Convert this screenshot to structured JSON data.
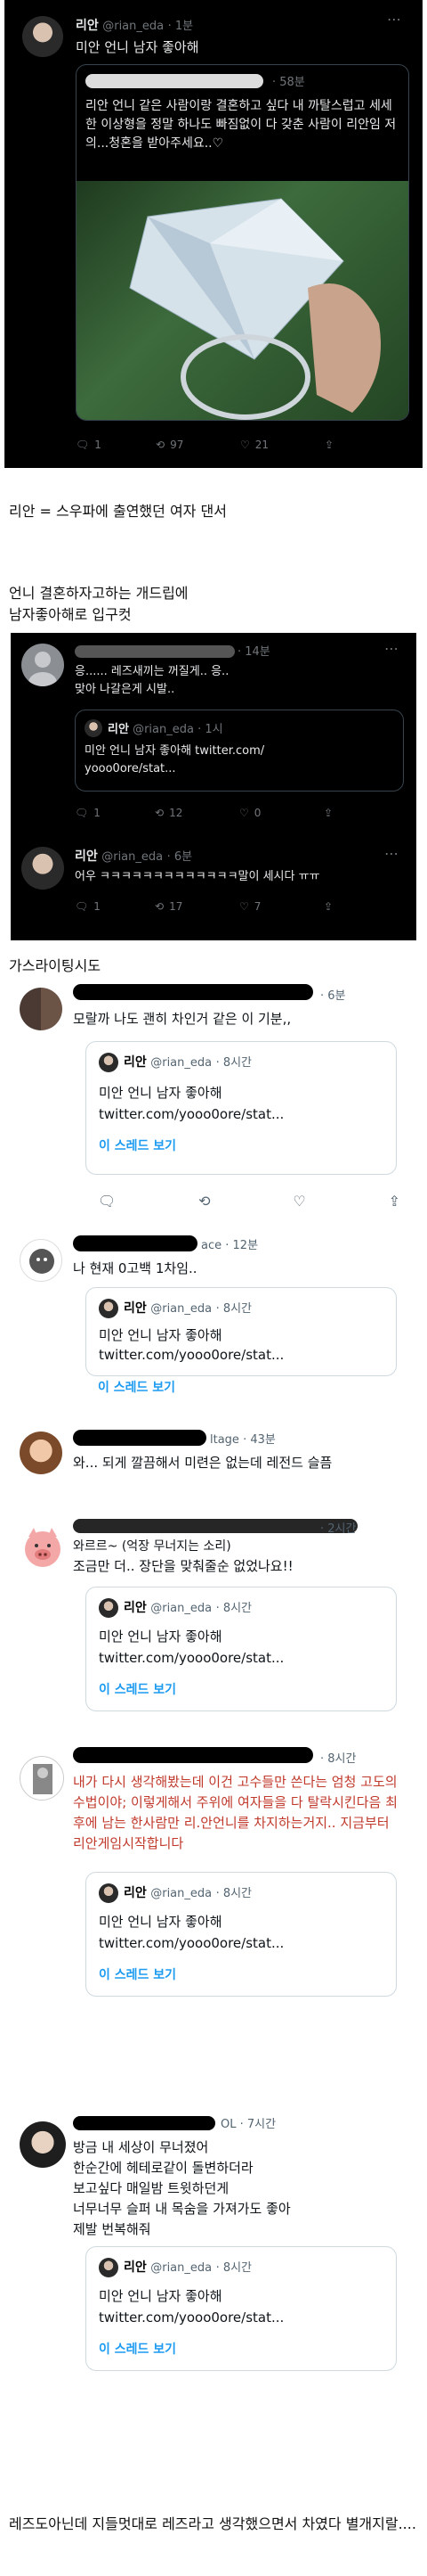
{
  "tweet1": {
    "name": "리안",
    "handle": "@rian_eda",
    "time": "1분",
    "text": "미안 언니 남자 좋아해",
    "quote": {
      "time": "58분",
      "text": "리안 언니 같은 사람이랑 결혼하고 싶다 내 까탈스럽고 세세한 이상형을 정말 하나도 빠짐없이 다 갖춘 사람이 리안임 저의...청혼을 받아주세요..♡"
    },
    "counts": {
      "reply": "1",
      "retweet": "97",
      "like": "21"
    }
  },
  "caption1": "리안 = 스우파에 출연했던 여자 댄서",
  "caption2": [
    "언니 결혼하자고하는 개드립에",
    "남자좋아해로 입구컷"
  ],
  "tweet2": {
    "time": "14분",
    "text": "응...... 레즈새끼는 꺼질게.. 응..\n맞아 나갈은게 시발..",
    "quote": {
      "name": "리안",
      "handle": "@rian_eda",
      "time": "1시",
      "text": "미안 언니 남자 좋아해 twitter.com/\nyooo0ore/stat..."
    },
    "counts": {
      "reply": "1",
      "retweet": "12",
      "like": "0"
    }
  },
  "tweet3": {
    "name": "리안",
    "handle": "@rian_eda",
    "time": "6분",
    "text": "어우 ㅋㅋㅋㅋㅋㅋㅋㅋㅋㅋㅋㅋㅋ말이 세시다 ㅠㅠ",
    "counts": {
      "reply": "1",
      "retweet": "17",
      "like": "7"
    }
  },
  "caption3": "가스라이팅시도",
  "quote_common": {
    "name": "리안",
    "handle": "@rian_eda",
    "time": "8시간",
    "line1": "미안 언니 남자 좋아해",
    "line2": "twitter.com/yooo0ore/stat...",
    "thread": "이 스레드 보기"
  },
  "replies": [
    {
      "time": "6분",
      "text": "모랄까 나도 괜히 차인거 같은 이 기분,,"
    },
    {
      "handle_tail": "ace",
      "time": "12분",
      "text": "나 현재 0고백 1차임.."
    },
    {
      "handle_tail": "ltage",
      "time": "43분",
      "text": "와... 되게 깔끔해서 미련은 없는데 레전드 슬픔"
    },
    {
      "name_tail": "(억장 무너지는 소리)",
      "name_prefix": "와르르~",
      "time": "2시간",
      "text": "조금만 더.. 장단을 맞춰줄순 없었나요!!"
    },
    {
      "time": "8시간",
      "text": "내가 다시 생각해봤는데 이건 고수들만 쓴다는 엄청 고도의수법이야; 이렇게해서 주위에 여자들을 다 탈락시킨다음 최후에 남는 한사람만 리.안언니를 차지하는거지.. 지금부터 리안게임시작합니다"
    },
    {
      "handle_tail": "OL",
      "time": "7시간",
      "text": "방금 내 세상이 무너졌어\n한순간에 헤테로같이 돌변하더라\n보고싶다 매일밤 트윗하던게\n너무너무 슬퍼 내 목숨을 가져가도 좋아\n제발 번복해줘"
    }
  ],
  "caption4": "레즈도아닌데 지들멋대로 레즈라고 생각했으면서 차였다 별개지랄...."
}
